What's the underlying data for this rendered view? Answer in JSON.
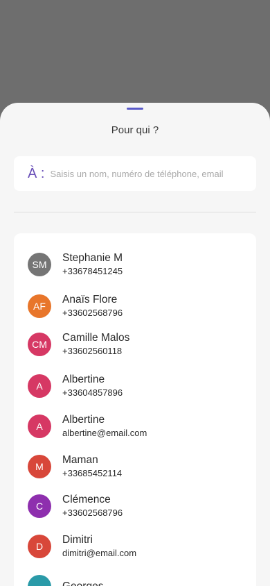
{
  "sheet": {
    "title": "Pour qui ?",
    "to_label": "À :",
    "search_placeholder": "Saisis un nom, numéro de téléphone, email"
  },
  "contacts": [
    {
      "initials": "SM",
      "name": "Stephanie M",
      "detail": "+33678451245",
      "color": "#757575"
    },
    {
      "initials": "AF",
      "name": "Anaïs Flore",
      "detail": "+33602568796",
      "color": "#e8762b"
    },
    {
      "initials": "CM",
      "name": "Camille Malos",
      "detail": "+33602560118",
      "color": "#d63864"
    },
    {
      "initials": "A",
      "name": "Albertine",
      "detail": "+33604857896",
      "color": "#d63864"
    },
    {
      "initials": "A",
      "name": "Albertine",
      "detail": "albertine@email.com",
      "color": "#d63864"
    },
    {
      "initials": "M",
      "name": "Maman",
      "detail": "+33685452114",
      "color": "#d8473a"
    },
    {
      "initials": "C",
      "name": "Clémence",
      "detail": "+33602568796",
      "color": "#8e2fae"
    },
    {
      "initials": "D",
      "name": "Dimitri",
      "detail": "dimitri@email.com",
      "color": "#d8473a"
    },
    {
      "initials": "",
      "name": "Georges",
      "detail": "",
      "color": "#2a9aa8"
    }
  ]
}
